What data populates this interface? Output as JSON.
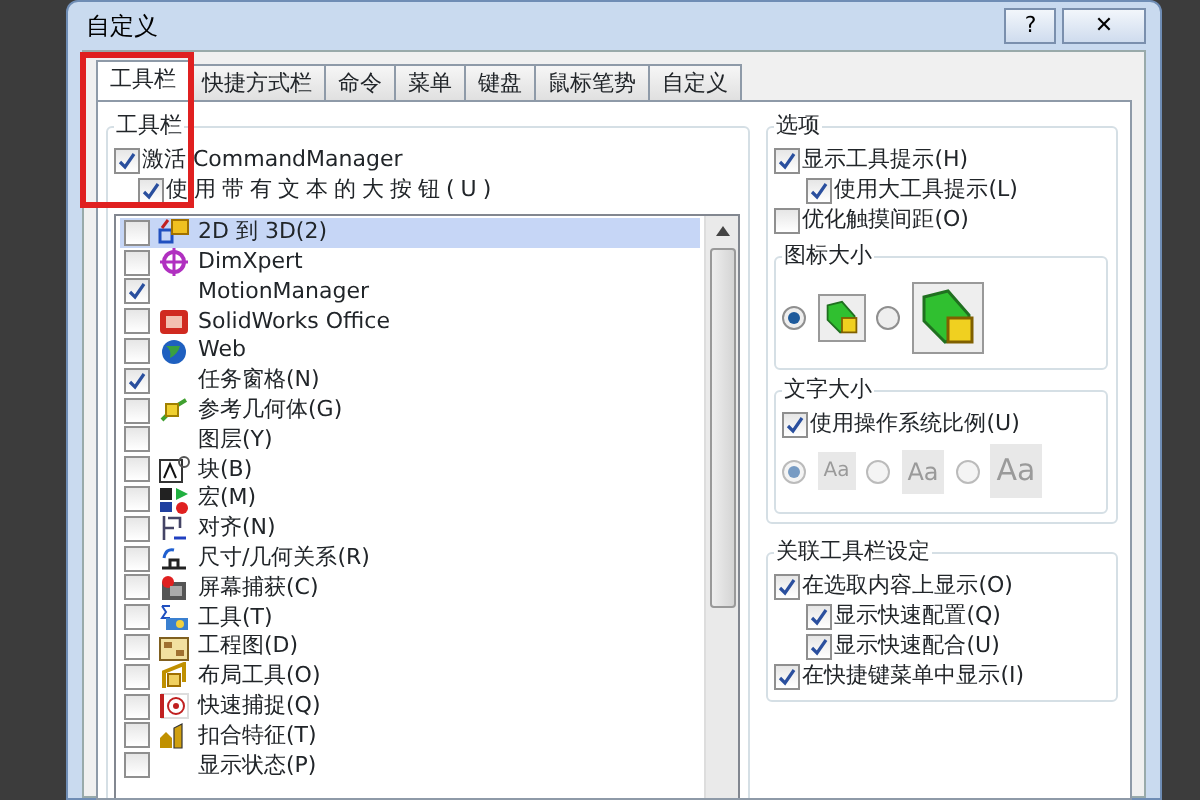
{
  "window": {
    "title": "自定义",
    "buttons": [
      {
        "kind": "help",
        "label": "?"
      },
      {
        "kind": "close",
        "label": "✕"
      }
    ]
  },
  "tabs": [
    {
      "label": "工具栏",
      "selected": true
    },
    {
      "label": "快捷方式栏",
      "selected": false
    },
    {
      "label": "命令",
      "selected": false
    },
    {
      "label": "菜单",
      "selected": false
    },
    {
      "label": "键盘",
      "selected": false
    },
    {
      "label": "鼠标笔势",
      "selected": false
    },
    {
      "label": "自定义",
      "selected": false
    }
  ],
  "toolbars": {
    "title": "工具栏",
    "options": [
      {
        "label": "激活 CommandManager",
        "checked": true,
        "children": [
          {
            "label": "使用带有文本的大按钮(U)",
            "checked": true
          }
        ]
      }
    ],
    "items": [
      {
        "label": "2D 到 3D(2)",
        "checked": false,
        "selected": true
      },
      {
        "label": "DimXpert",
        "checked": false,
        "selected": false
      },
      {
        "label": "MotionManager",
        "checked": true,
        "selected": false
      },
      {
        "label": "SolidWorks Office",
        "checked": false,
        "selected": false
      },
      {
        "label": "Web",
        "checked": false,
        "selected": false
      },
      {
        "label": "任务窗格(N)",
        "checked": true,
        "selected": false
      },
      {
        "label": "参考几何体(G)",
        "checked": false,
        "selected": false
      },
      {
        "label": "图层(Y)",
        "checked": false,
        "selected": false
      },
      {
        "label": "块(B)",
        "checked": false,
        "selected": false
      },
      {
        "label": "宏(M)",
        "checked": false,
        "selected": false
      },
      {
        "label": "对齐(N)",
        "checked": false,
        "selected": false
      },
      {
        "label": "尺寸/几何关系(R)",
        "checked": false,
        "selected": false
      },
      {
        "label": "屏幕捕获(C)",
        "checked": false,
        "selected": false
      },
      {
        "label": "工具(T)",
        "checked": false,
        "selected": false
      },
      {
        "label": "工程图(D)",
        "checked": false,
        "selected": false
      },
      {
        "label": "布局工具(O)",
        "checked": false,
        "selected": false
      },
      {
        "label": "快速捕捉(Q)",
        "checked": false,
        "selected": false
      },
      {
        "label": "扣合特征(T)",
        "checked": false,
        "selected": false
      },
      {
        "label": "显示状态(P)",
        "checked": false,
        "selected": false
      }
    ]
  },
  "options": {
    "title": "选项",
    "checks": [
      {
        "label": "显示工具提示(H)",
        "checked": true,
        "children": [
          {
            "label": "使用大工具提示(L)",
            "checked": true
          }
        ]
      },
      {
        "label": "优化触摸间距(O)",
        "checked": false
      }
    ],
    "icon_size": {
      "title": "图标大小",
      "choices": [
        {
          "kind": "small",
          "selected": true
        },
        {
          "kind": "large",
          "selected": false
        }
      ]
    },
    "text_size": {
      "title": "文字大小",
      "check": {
        "label": "使用操作系统比例(U)",
        "checked": true
      },
      "choices": [
        {
          "label": "Aa",
          "kind": "small",
          "selected": true,
          "disabled": true
        },
        {
          "label": "Aa",
          "kind": "medium",
          "selected": false,
          "disabled": true
        },
        {
          "label": "Aa",
          "kind": "large",
          "selected": false,
          "disabled": true
        }
      ]
    }
  },
  "context_toolbar": {
    "title": "关联工具栏设定",
    "checks": [
      {
        "label": "在选取内容上显示(O)",
        "checked": true,
        "children": [
          {
            "label": "显示快速配置(Q)",
            "checked": true
          },
          {
            "label": "显示快速配合(U)",
            "checked": true
          }
        ]
      },
      {
        "label": "在快捷键菜单中显示(I)",
        "checked": true
      }
    ]
  },
  "highlight_box": true
}
